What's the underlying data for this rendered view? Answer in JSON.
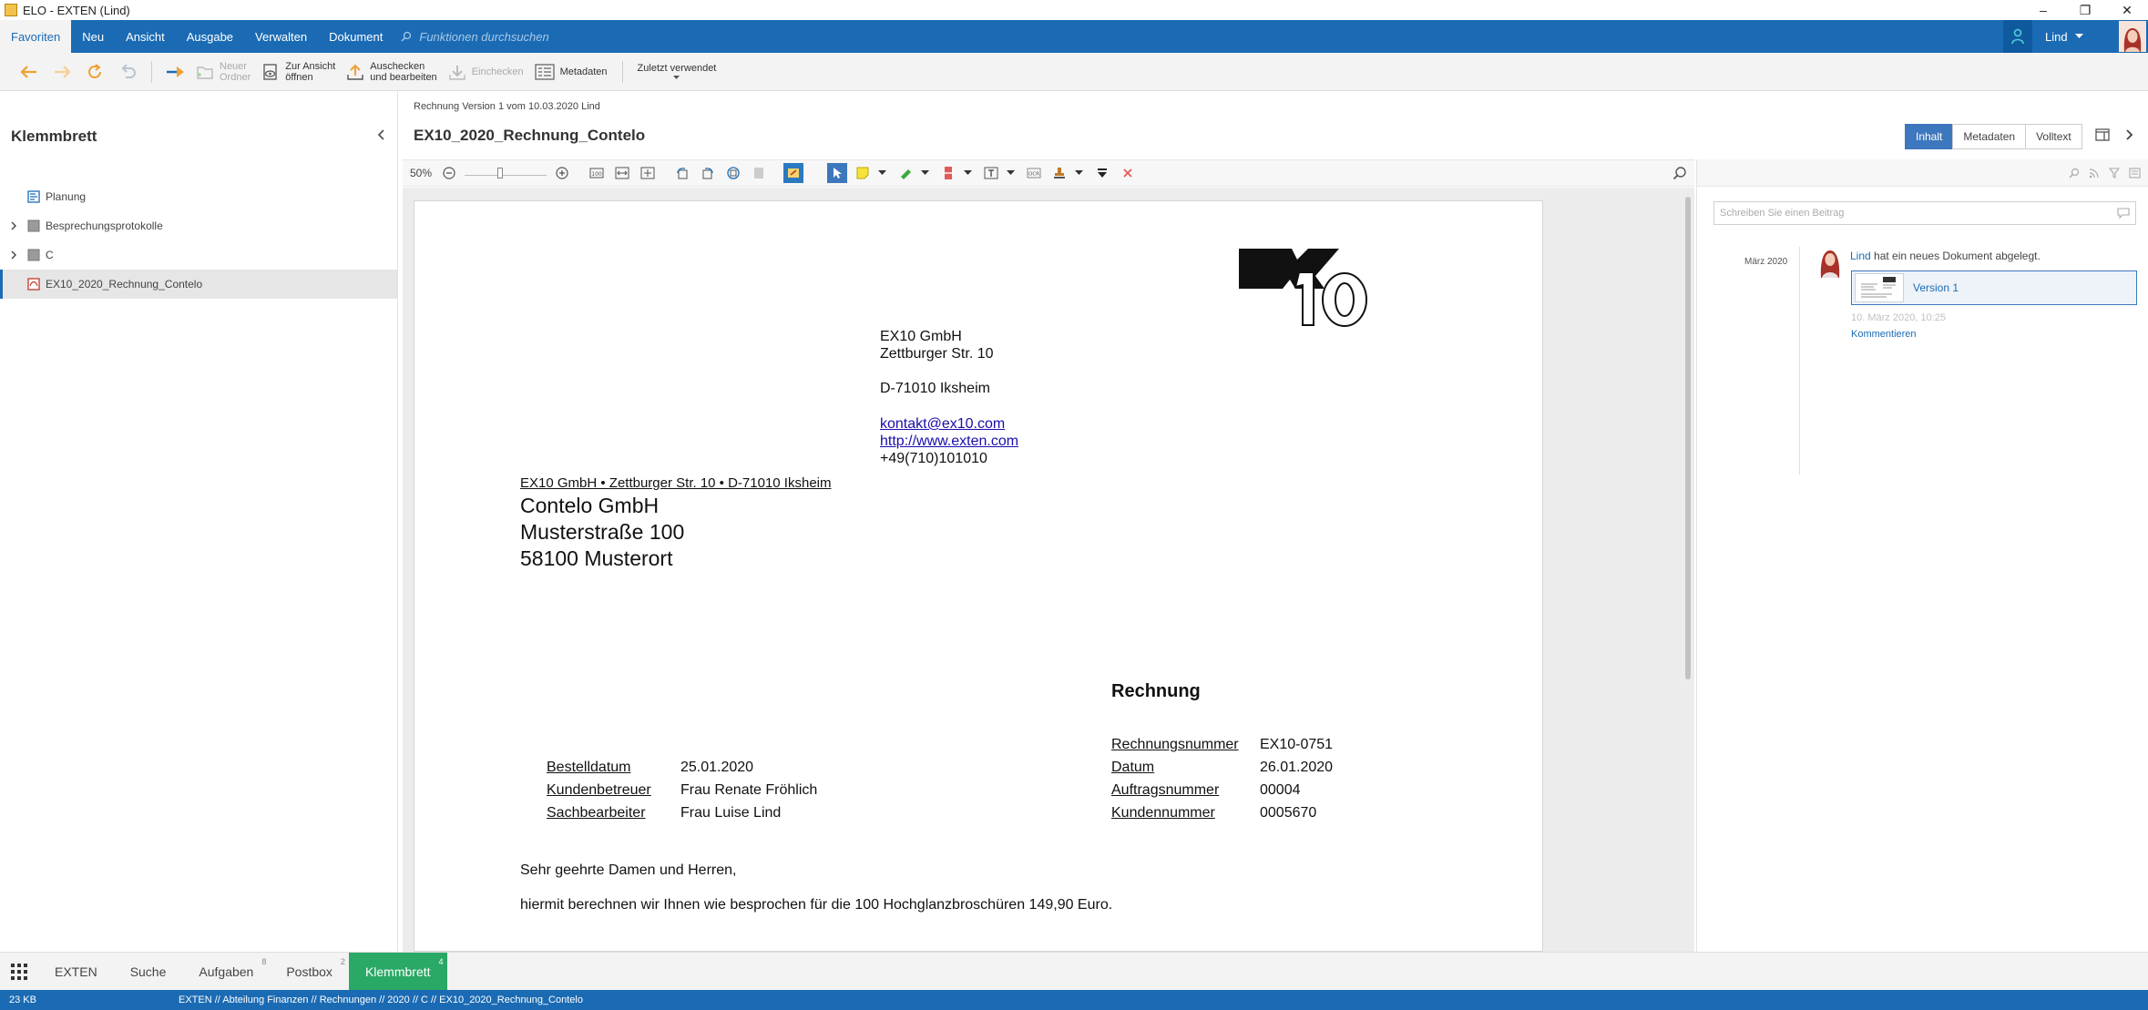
{
  "window": {
    "title": "ELO - EXTEN (Lind)",
    "controls": [
      "–",
      "❐",
      "✕"
    ]
  },
  "menu": {
    "items": [
      "Favoriten",
      "Neu",
      "Ansicht",
      "Ausgabe",
      "Verwalten",
      "Dokument"
    ],
    "search_placeholder": "Funktionen durchsuchen",
    "user": "Lind"
  },
  "toolbar": {
    "new_folder": [
      "Neuer",
      "Ordner"
    ],
    "open_view": [
      "Zur Ansicht",
      "öffnen"
    ],
    "checkout": [
      "Auschecken",
      "und bearbeiten"
    ],
    "checkin": "Einchecken",
    "metadata": "Metadaten",
    "recent": "Zuletzt verwendet"
  },
  "clipboard": {
    "title": "Klemmbrett",
    "items": [
      {
        "label": "Planung",
        "icon": "form-icon",
        "expandable": false
      },
      {
        "label": "Besprechungsprotokolle",
        "icon": "folder-icon",
        "expandable": true
      },
      {
        "label": "C",
        "icon": "folder-icon",
        "expandable": true
      },
      {
        "label": "EX10_2020_Rechnung_Contelo",
        "icon": "pdf-icon",
        "expandable": false,
        "selected": true
      }
    ]
  },
  "document": {
    "info": "Rechnung  Version 1 vom 10.03.2020 Lind",
    "title": "EX10_2020_Rechnung_Contelo",
    "view_tabs": [
      "Inhalt",
      "Metadaten",
      "Volltext"
    ],
    "active_tab": "Inhalt",
    "zoom": "50%"
  },
  "invoice": {
    "logo_text": "EX10",
    "sender_line": "EX10 GmbH • Zettburger Str. 10 • D-71010 Iksheim",
    "recipient": [
      "Contelo GmbH",
      "Musterstraße 100",
      "58100 Musterort"
    ],
    "company": {
      "name": "EX10 GmbH",
      "street": "Zettburger Str. 10",
      "city": "D-71010 Iksheim",
      "email": "kontakt@ex10.com",
      "web": "http://www.exten.com",
      "phone": "+49(710)101010"
    },
    "heading": "Rechnung",
    "left_fields": [
      {
        "label": "Bestelldatum",
        "value": "25.01.2020"
      },
      {
        "label": "Kundenbetreuer",
        "value": "Frau Renate Fröhlich"
      },
      {
        "label": "Sachbearbeiter",
        "value": "Frau Luise Lind"
      }
    ],
    "right_fields": [
      {
        "label": "Rechnungsnummer",
        "value": "EX10-0751"
      },
      {
        "label": "Datum",
        "value": "26.01.2020"
      },
      {
        "label": "Auftragsnummer",
        "value": "00004"
      },
      {
        "label": "Kundennummer",
        "value": "0005670"
      }
    ],
    "greeting": "Sehr geehrte Damen und Herren,",
    "body": "hiermit berechnen wir Ihnen wie besprochen für die 100 Hochglanzbroschüren 149,90 Euro."
  },
  "feed": {
    "placeholder": "Schreiben Sie einen Beitrag",
    "month": "März 2020",
    "user": "Lind",
    "action": " hat ein neues Dokument abgelegt.",
    "version": "Version 1",
    "date": "10. März 2020, 10:25",
    "comment": "Kommentieren"
  },
  "bottom_tabs": [
    {
      "label": "EXTEN",
      "badge": ""
    },
    {
      "label": "Suche",
      "badge": ""
    },
    {
      "label": "Aufgaben",
      "badge": "8"
    },
    {
      "label": "Postbox",
      "badge": "2"
    },
    {
      "label": "Klemmbrett",
      "badge": "4",
      "active": true
    }
  ],
  "status": {
    "size": "23 KB",
    "path": "EXTEN // Abteilung Finanzen // Rechnungen // 2020 // C // EX10_2020_Rechnung_Contelo"
  },
  "colors": {
    "brand_blue": "#1b6bb4",
    "active_green": "#2aa866",
    "accent_orange": "#f0a030"
  }
}
